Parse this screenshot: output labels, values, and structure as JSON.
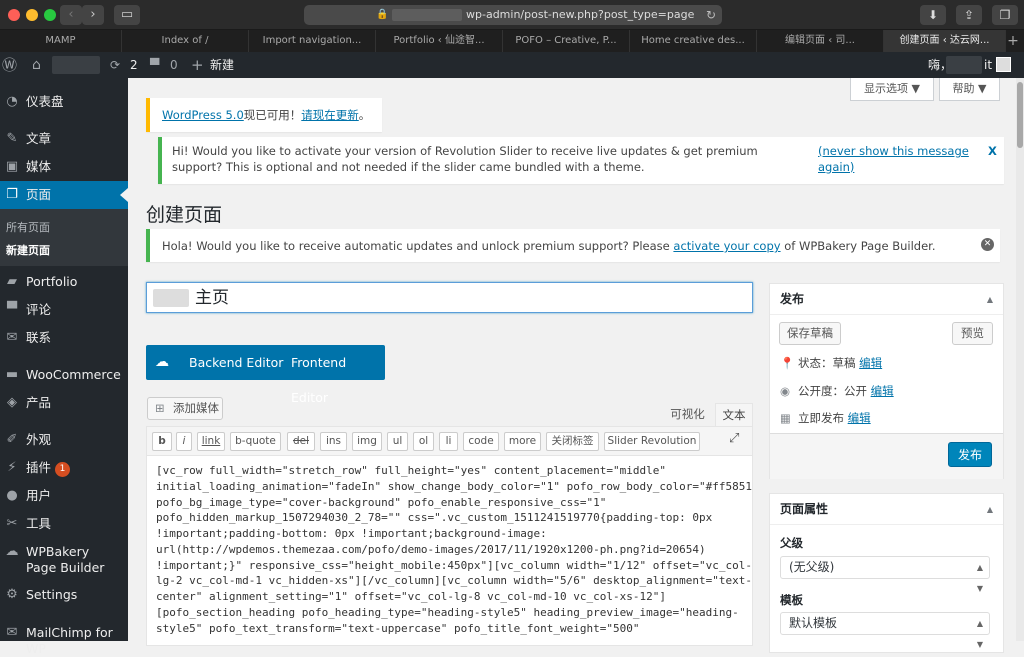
{
  "browser": {
    "url": "wp-admin/post-new.php?post_type=page",
    "tabs": [
      "MAMP",
      "Index of /",
      "Import navigation...",
      "Portfolio ‹ 仙途智...",
      "POFO – Creative, P...",
      "Home creative des...",
      "编辑页面 ‹     司...",
      "创建页面 ‹ 达云网..."
    ],
    "active_tab": 7
  },
  "adminbar": {
    "updates_count": "2",
    "comments_count": "0",
    "new_label": "新建",
    "greeting": "嗨，",
    "greeting_suffix": "it"
  },
  "sidebar": {
    "items": [
      {
        "label": "仪表盘",
        "icon": "dashboard-icon"
      },
      {
        "label": "文章",
        "icon": "pin-icon"
      },
      {
        "label": "媒体",
        "icon": "media-icon"
      },
      {
        "label": "页面",
        "icon": "pages-icon"
      },
      {
        "label": "Portfolio",
        "icon": "portfolio-icon"
      },
      {
        "label": "评论",
        "icon": "comments-icon"
      },
      {
        "label": "联系",
        "icon": "mail-icon"
      },
      {
        "label": "WooCommerce",
        "icon": "woocommerce-icon"
      },
      {
        "label": "产品",
        "icon": "products-icon"
      },
      {
        "label": "外观",
        "icon": "appearance-icon"
      },
      {
        "label": "插件",
        "icon": "plugins-icon",
        "badge": "1"
      },
      {
        "label": "用户",
        "icon": "users-icon"
      },
      {
        "label": "工具",
        "icon": "tools-icon"
      },
      {
        "label": "WPBakery Page Builder",
        "icon": "wpbakery-icon"
      },
      {
        "label": "Settings",
        "icon": "settings-icon"
      },
      {
        "label": "MailChimp for WP",
        "icon": "mailchimp-icon"
      }
    ],
    "submenu": [
      "所有页面",
      "新建页面"
    ]
  },
  "header": {
    "screen_options": "显示选项 ▼",
    "help": "帮助 ▼"
  },
  "notices": {
    "update_link": "WordPress 5.0",
    "update_text": "现已可用！",
    "update_now": "请现在更新",
    "update_end": "。",
    "revslider_text": "Hi! Would you like to activate your version of Revolution Slider to receive live updates & get premium support? This is optional and not needed if the slider came bundled with a theme.",
    "revslider_never": "(never show this message again)",
    "revslider_x": "X",
    "wpb_pre": "Hola! Would you like to receive automatic updates and unlock premium support? Please ",
    "wpb_link": "activate your copy",
    "wpb_post": " of WPBakery Page Builder."
  },
  "page": {
    "title": "创建页面",
    "post_title": "主页"
  },
  "builder": {
    "backend": "Backend Editor",
    "frontend": "Frontend Editor"
  },
  "editor": {
    "add_media": "添加媒体",
    "tab_visual": "可视化",
    "tab_text": "文本",
    "quicktags": [
      "b",
      "i",
      "link",
      "b-quote",
      "del",
      "ins",
      "img",
      "ul",
      "ol",
      "li",
      "code",
      "more",
      "关闭标签",
      "Slider Revolution"
    ],
    "content_lines": [
      "[vc_row full_width=\"stretch_row\" full_height=\"yes\" content_placement=\"middle\"",
      "initial_loading_animation=\"fadeIn\" show_change_body_color=\"1\" pofo_row_body_color=\"#ff5851\"",
      "pofo_bg_image_type=\"cover-background\" pofo_enable_responsive_css=\"1\"",
      "pofo_hidden_markup_1507294030_2_78=\"\" css=\".vc_custom_1511241519770{padding-top: 0px",
      "!important;padding-bottom: 0px !important;background-image:",
      "url(http://wpdemos.themezaa.com/pofo/demo-images/2017/11/1920x1200-ph.png?id=20654)",
      "!important;}\" responsive_css=\"height_mobile:450px\"][vc_column width=\"1/12\" offset=\"vc_col-",
      "lg-2 vc_col-md-1 vc_hidden-xs\"][/vc_column][vc_column width=\"5/6\" desktop_alignment=\"text-",
      "center\" alignment_setting=\"1\" offset=\"vc_col-lg-8 vc_col-md-10 vc_col-xs-12\"]",
      "[pofo_section_heading pofo_heading_type=\"heading-style5\" heading_preview_image=\"heading-",
      "style5\" pofo_text_transform=\"text-uppercase\" pofo_title_font_weight=\"500\""
    ]
  },
  "publish": {
    "title": "发布",
    "save_draft": "保存草稿",
    "preview": "预览",
    "status_label": "状态：",
    "status_value": "草稿",
    "visibility_label": "公开度：",
    "visibility_value": "公开",
    "schedule_label": "立即发布",
    "edit": "编辑",
    "publish_button": "发布"
  },
  "attributes": {
    "title": "页面属性",
    "parent_label": "父级",
    "parent_value": "(无父级)",
    "template_label": "模板",
    "template_value": "默认模板"
  },
  "colors": {
    "admin_dark": "#23282d",
    "accent_blue": "#0073aa",
    "notice_warn": "#ffb900",
    "notice_ok": "#46b450"
  }
}
